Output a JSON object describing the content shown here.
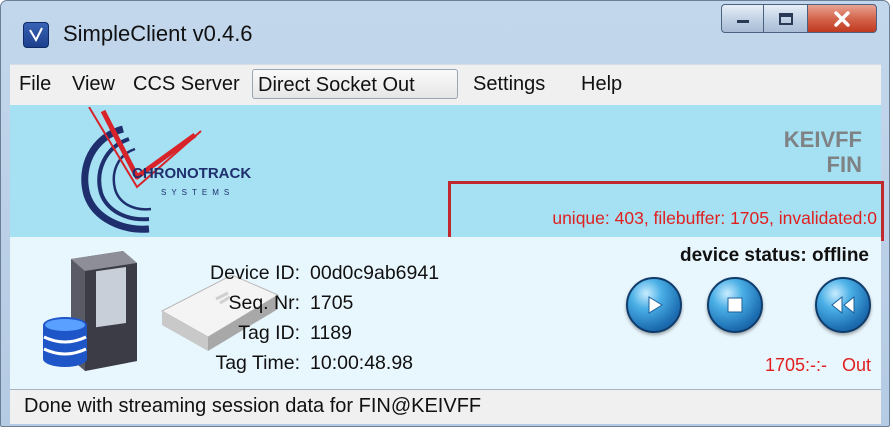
{
  "window": {
    "title": "SimpleClient v0.4.6",
    "icon": "app-icon"
  },
  "window_buttons": [
    "minimize-icon",
    "maximize-icon",
    "close-icon"
  ],
  "menu": {
    "items": [
      {
        "label": "File"
      },
      {
        "label": "View"
      },
      {
        "label": "CCS Server"
      },
      {
        "label": "Direct Socket Out",
        "active": true
      },
      {
        "label": "Settings"
      },
      {
        "label": "Help"
      }
    ]
  },
  "banner": {
    "logo_text": "CHRONOTRACK",
    "logo_sub": "SYSTEMS",
    "user_name": "KEIVFF",
    "user_sub": "FIN",
    "stats": "unique: 403, filebuffer: 1705, invalidated:0",
    "colors": {
      "banner_bg": "#a5e1f2",
      "stats_red": "#e02020",
      "highlight_border": "#c0282d"
    }
  },
  "device": {
    "labels": {
      "id": "Device ID:",
      "seq": "Seq. Nr:",
      "tag": "Tag ID:",
      "time": "Tag Time:"
    },
    "values": {
      "id": "00d0c9ab6941",
      "seq": "1705",
      "tag": "1189",
      "time": "10:00:48.98"
    },
    "status": "device status: offline",
    "counter": "1705:-:- Out",
    "buttons": [
      "play-icon",
      "stop-icon",
      "rewind-icon"
    ]
  },
  "statusbar": {
    "text": "Done with streaming session data for FIN@KEIVFF"
  }
}
